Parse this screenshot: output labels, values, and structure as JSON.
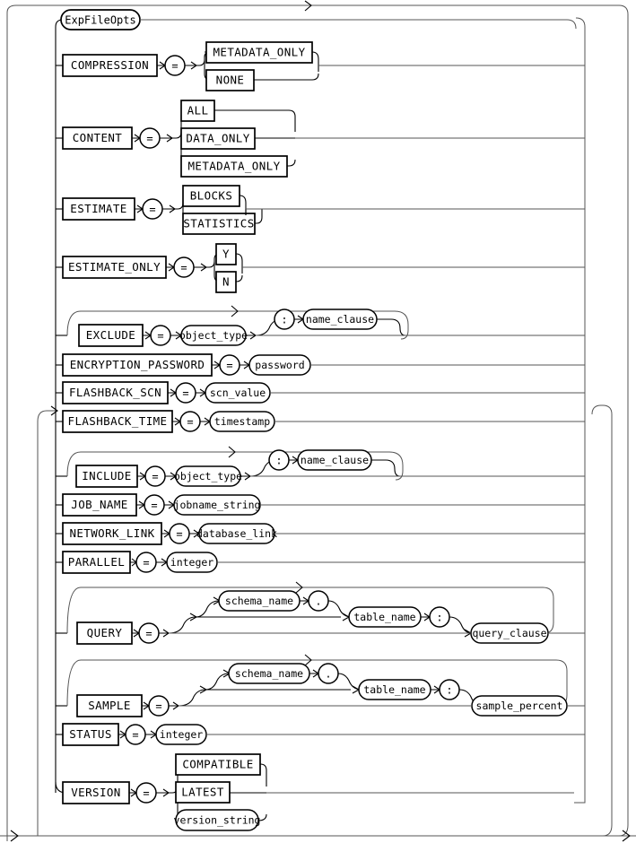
{
  "diagram": {
    "type": "railroad-syntax-diagram",
    "title": "ExpFileOpts",
    "entry_label": "ExpFileOpts",
    "loop_arrow_glyph": "<",
    "colors": {
      "line": "#000000",
      "background": "#ffffff",
      "thin_line": "#555555"
    },
    "operators": {
      "equals": "=",
      "colon": ":",
      "dot": "."
    },
    "rows": [
      {
        "id": "compression",
        "keyword": "COMPRESSION",
        "operator": "=",
        "choices": [
          "METADATA_ONLY",
          "NONE"
        ],
        "choice_kind": "terminal"
      },
      {
        "id": "content",
        "keyword": "CONTENT",
        "operator": "=",
        "choices": [
          "ALL",
          "DATA_ONLY",
          "METADATA_ONLY"
        ],
        "choice_kind": "terminal"
      },
      {
        "id": "estimate",
        "keyword": "ESTIMATE",
        "operator": "=",
        "choices": [
          "BLOCKS",
          "STATISTICS"
        ],
        "choice_kind": "terminal"
      },
      {
        "id": "estimate_only",
        "keyword": "ESTIMATE_ONLY",
        "operator": "=",
        "choices": [
          "Y",
          "N"
        ],
        "choice_kind": "terminal"
      },
      {
        "id": "exclude",
        "keyword": "EXCLUDE",
        "operator": "=",
        "value": "object_type",
        "optional_operator": ":",
        "optional_value": "name_clause",
        "repeatable": true
      },
      {
        "id": "encryption_password",
        "keyword": "ENCRYPTION_PASSWORD",
        "operator": "=",
        "value": "password"
      },
      {
        "id": "flashback_scn",
        "keyword": "FLASHBACK_SCN",
        "operator": "=",
        "value": "scn_value"
      },
      {
        "id": "flashback_time",
        "keyword": "FLASHBACK_TIME",
        "operator": "=",
        "value": "timestamp"
      },
      {
        "id": "include",
        "keyword": "INCLUDE",
        "operator": "=",
        "value": "object_type",
        "optional_operator": ":",
        "optional_value": "name_clause",
        "repeatable": true
      },
      {
        "id": "job_name",
        "keyword": "JOB_NAME",
        "operator": "=",
        "value": "jobname_string"
      },
      {
        "id": "network_link",
        "keyword": "NETWORK_LINK",
        "operator": "=",
        "value": "database_link"
      },
      {
        "id": "parallel",
        "keyword": "PARALLEL",
        "operator": "=",
        "value": "integer"
      },
      {
        "id": "query",
        "keyword": "QUERY",
        "operator": "=",
        "schema": "schema_name",
        "dot": ".",
        "table": "table_name",
        "colon": ":",
        "value": "query_clause",
        "repeatable": true
      },
      {
        "id": "sample",
        "keyword": "SAMPLE",
        "operator": "=",
        "schema": "schema_name",
        "dot": ".",
        "table": "table_name",
        "colon": ":",
        "value": "sample_percent",
        "repeatable": true
      },
      {
        "id": "status",
        "keyword": "STATUS",
        "operator": "=",
        "value": "integer"
      },
      {
        "id": "version",
        "keyword": "VERSION",
        "operator": "=",
        "choices": [
          "COMPATIBLE",
          "LATEST"
        ],
        "choice_kind": "terminal",
        "nonterminal_choice": "version_string"
      }
    ]
  }
}
